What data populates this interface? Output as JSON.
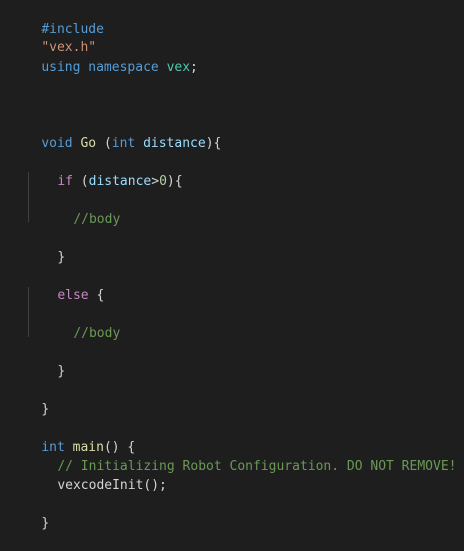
{
  "code": {
    "l1": {
      "kw": "#include",
      "str": "\"vex.h\""
    },
    "l2": {
      "kw1": "using",
      "kw2": "namespace",
      "ns": "vex",
      "semi": ";"
    },
    "l3": {
      "kw": "void",
      "fn": "Go",
      "open": "(",
      "type": "int",
      "param": "distance",
      "close": "){"
    },
    "l4": {
      "kw": "if",
      "open": "(",
      "param": "distance",
      "op": ">",
      "num": "0",
      "close": "){"
    },
    "l5": {
      "cmt": "//body"
    },
    "l6": {
      "brace": "}"
    },
    "l7": {
      "kw": "else",
      "brace": "{"
    },
    "l8": {
      "cmt": "//body"
    },
    "l9": {
      "brace": "}"
    },
    "l10": {
      "brace": "}"
    },
    "l11": {
      "kw": "int",
      "fn": "main",
      "rest": "() {"
    },
    "l12": {
      "cmt": "// Initializing Robot Configuration. DO NOT REMOVE!"
    },
    "l13": {
      "fn": "vexcodeInit",
      "rest": "();"
    },
    "l14": {
      "brace": "}"
    }
  }
}
